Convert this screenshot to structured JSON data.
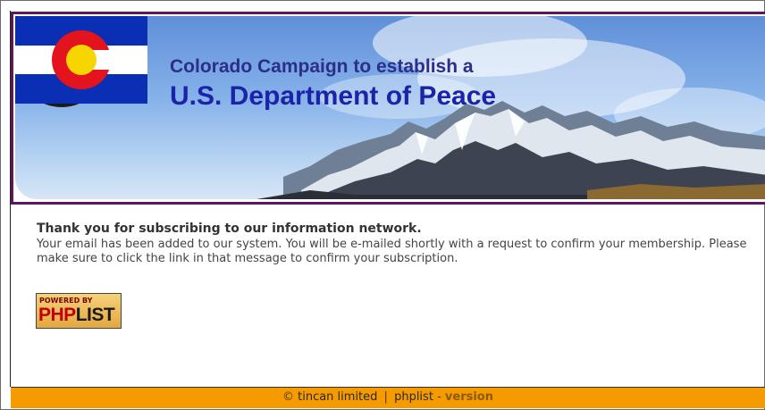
{
  "header": {
    "title_line1": "Colorado Campaign to establish a",
    "title_line2": "U.S. Department of Peace"
  },
  "message": {
    "heading": "Thank you for subscribing to our information network.",
    "body": "Your email has been added to our system. You will be e-mailed shortly with a request to confirm your membership. Please make sure to click the link in that message to confirm your subscription."
  },
  "badge": {
    "top": "POWERED BY",
    "php": "PHP",
    "list": "LIST"
  },
  "footer": {
    "copyright_symbol": "©",
    "company": "tincan limited",
    "separator": "|",
    "product": "phplist",
    "dash": "-",
    "version": "version"
  },
  "colors": {
    "footer_bg": "#f59b00",
    "banner_border": "#5a1a5a",
    "title": "#1b23a8"
  }
}
